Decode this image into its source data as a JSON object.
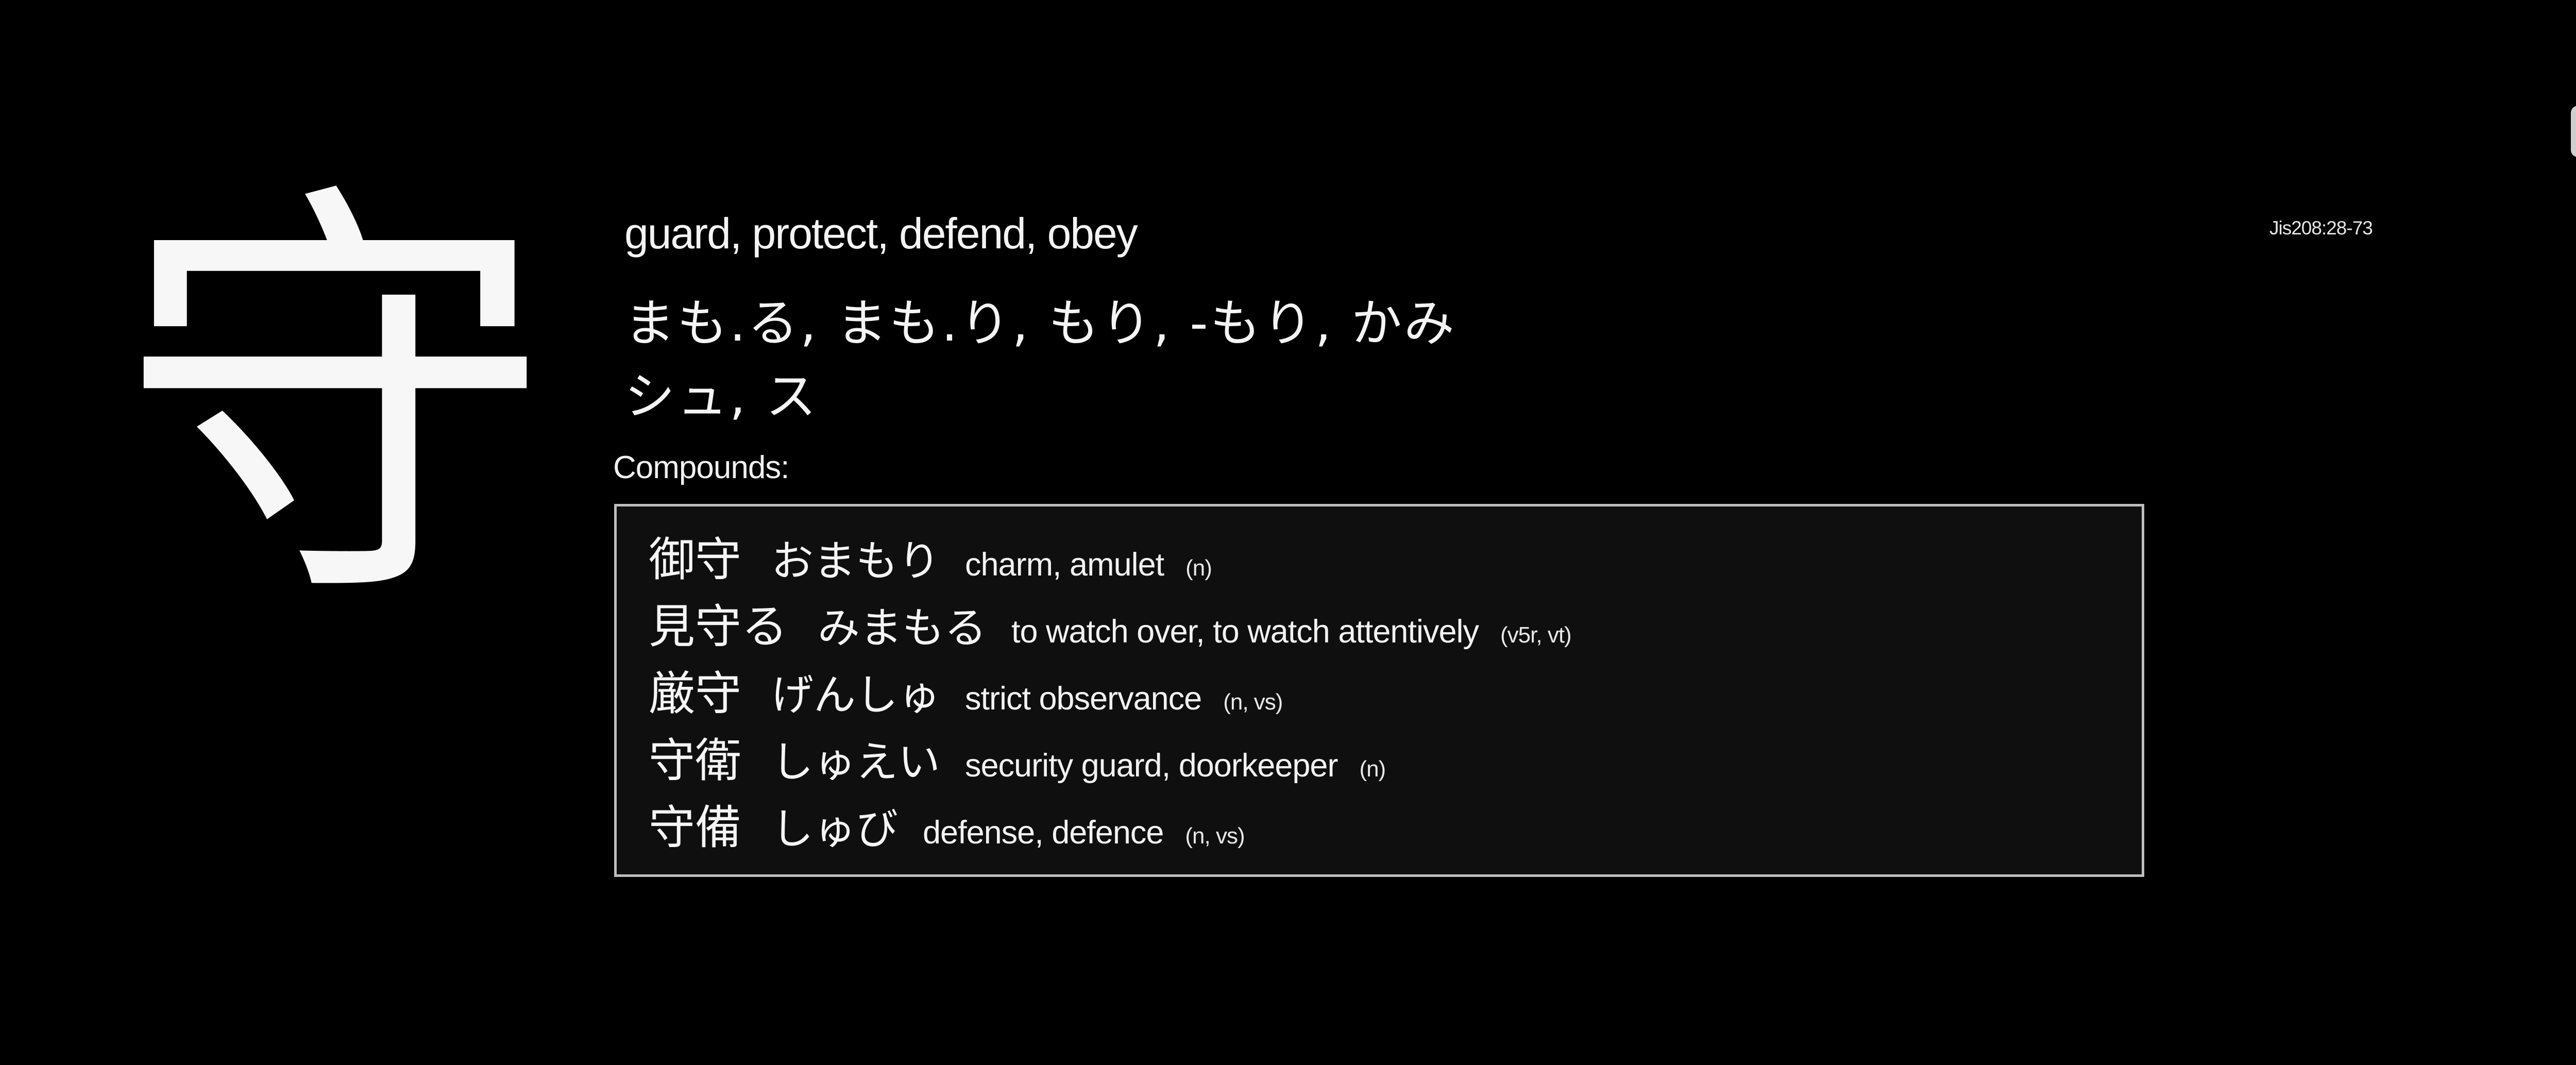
{
  "kanji": {
    "character": "守",
    "jis_code": "Jis208:28-73",
    "meanings": "guard, protect, defend, obey",
    "kun_readings": "まも.る, まも.り, もり, -もり, かみ",
    "on_readings": "シュ, ス"
  },
  "compounds": {
    "label": "Compounds:",
    "items": [
      {
        "word": "御守",
        "reading": "おまもり",
        "meaning": "charm, amulet",
        "pos": "(n)"
      },
      {
        "word": "見守る",
        "reading": "みまもる",
        "meaning": "to watch over, to watch attentively",
        "pos": "(v5r, vt)"
      },
      {
        "word": "厳守",
        "reading": "げんしゅ",
        "meaning": "strict observance",
        "pos": "(n, vs)"
      },
      {
        "word": "守衛",
        "reading": "しゅえい",
        "meaning": "security guard, doorkeeper",
        "pos": "(n)"
      },
      {
        "word": "守備",
        "reading": "しゅび",
        "meaning": "defense, defence",
        "pos": "(n, vs)"
      }
    ]
  },
  "colors": {
    "background": "#000000",
    "text": "#f4f4f4",
    "box_border": "#bdbdbd",
    "box_background": "#0f0f0f"
  }
}
